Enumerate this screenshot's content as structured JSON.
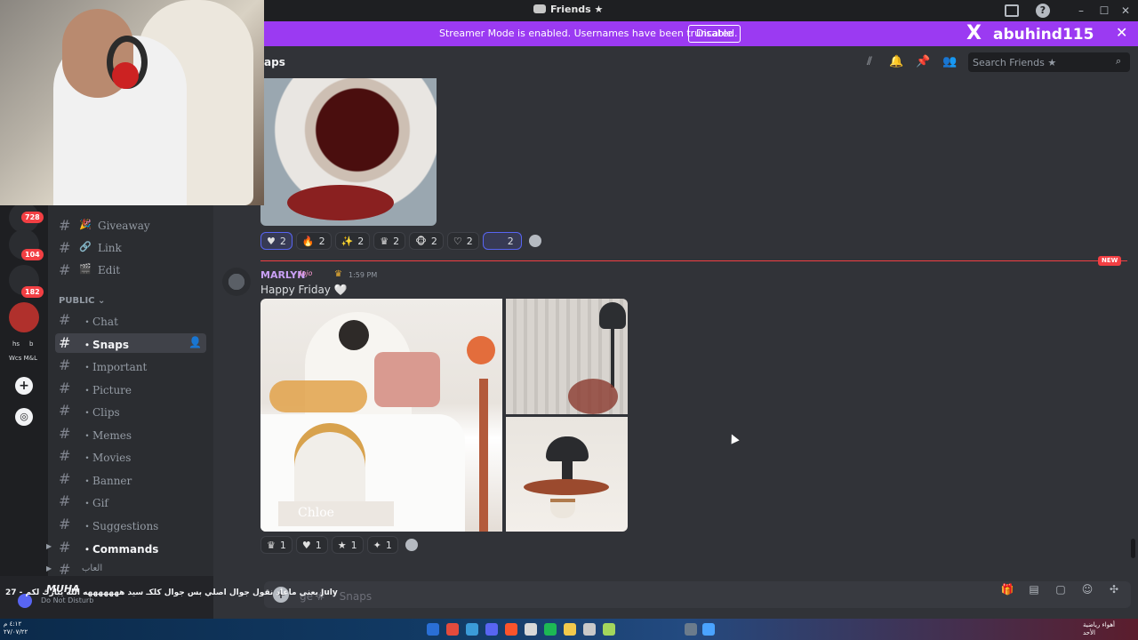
{
  "window": {
    "title": "Friends ★"
  },
  "banner": {
    "message": "Streamer Mode is enabled. Usernames have been truncated.",
    "disable_label": "Disable",
    "x_logo": "X",
    "handle": "abuhind115",
    "close": "✕"
  },
  "header": {
    "channel_title": "aps",
    "search_placeholder": "Search Friends ★"
  },
  "servers": [
    {
      "badge": "728"
    },
    {
      "badge": "104"
    },
    {
      "badge": "182"
    }
  ],
  "server_labels": {
    "hs": "hs",
    "b": "b",
    "wcs": "Wcs M&L"
  },
  "channels": {
    "top": [
      {
        "name": "Giveaway",
        "icon": "🎉"
      },
      {
        "name": "Link",
        "icon": "🔗"
      },
      {
        "name": "Edit",
        "icon": "🎬"
      }
    ],
    "category": "PUBLIC ⌄",
    "public": [
      {
        "name": "・Chat",
        "active": false
      },
      {
        "name": "・Snaps",
        "active": true
      },
      {
        "name": "・Important",
        "active": false
      },
      {
        "name": "・Picture",
        "active": false
      },
      {
        "name": "・Clips",
        "active": false
      },
      {
        "name": "・Memes",
        "active": false
      },
      {
        "name": "・Movies",
        "active": false
      },
      {
        "name": "・Banner",
        "active": false
      },
      {
        "name": "・Gif",
        "active": false
      },
      {
        "name": "・Suggestions",
        "active": false
      },
      {
        "name": "・Commands",
        "active": false
      },
      {
        "name": "العاب",
        "active": false
      }
    ]
  },
  "reactions_top": [
    {
      "emoji": "♥",
      "count": "2"
    },
    {
      "emoji": "🔥",
      "count": "2"
    },
    {
      "emoji": "✨",
      "count": "2"
    },
    {
      "emoji": "♛",
      "count": "2"
    },
    {
      "emoji": "🐵",
      "count": "2"
    },
    {
      "emoji": "♡",
      "count": "2"
    },
    {
      "emoji": "",
      "count": "2"
    }
  ],
  "new_tag": "NEW",
  "message": {
    "author": "MARLYN",
    "role_tag": "Jojo",
    "crown": "♛",
    "time": "1:59 PM",
    "text": "Happy Friday 🤍",
    "image_caption": "Chloe"
  },
  "reactions_bottom": [
    {
      "emoji": "♛",
      "count": "1"
    },
    {
      "emoji": "♥",
      "count": "1"
    },
    {
      "emoji": "★",
      "count": "1"
    },
    {
      "emoji": "✦",
      "count": "1"
    }
  ],
  "input": {
    "placeholder": "ge # ・Snaps"
  },
  "user": {
    "name": "MUHA",
    "status": "Do Not Disturb",
    "ticker": "يعني ماعاد نقول جوال اصلي بس جوال كلكـ سيد هههههههه الله يبارك لكم - 27 July"
  },
  "taskbar": {
    "clock": "٤:١٢ م\n٢٧/٠٧/٢٢",
    "right": "أهواء رياضية\nالأحد"
  },
  "colors": {
    "banner": "#9b3af2",
    "new_line": "#f23f43",
    "author": "#c9a0f5"
  }
}
